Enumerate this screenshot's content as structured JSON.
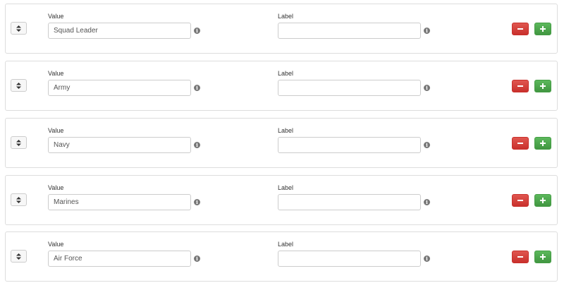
{
  "field_labels": {
    "value": "Value",
    "label": "Label"
  },
  "icons": {
    "sort": "sort-icon",
    "info": "info-icon",
    "remove": "minus-icon",
    "add": "plus-icon"
  },
  "colors": {
    "remove_button": "#d9534f",
    "add_button": "#5cb85c",
    "info_icon": "#777777"
  },
  "rows": [
    {
      "value": "Squad Leader",
      "label": ""
    },
    {
      "value": "Army",
      "label": ""
    },
    {
      "value": "Navy",
      "label": ""
    },
    {
      "value": "Marines",
      "label": ""
    },
    {
      "value": "Air Force",
      "label": ""
    }
  ]
}
